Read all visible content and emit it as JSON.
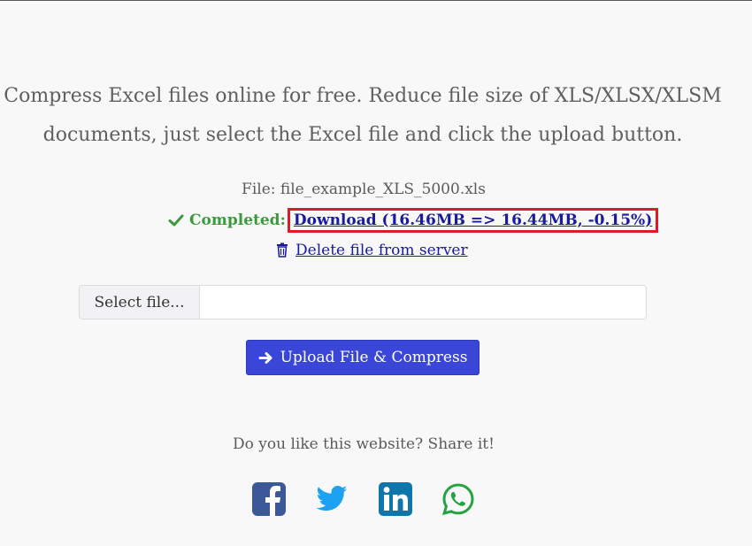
{
  "intro": {
    "line1": "Compress Excel files online for free. Reduce file size of XLS/XLSX/XLSM",
    "line2": "documents, just select the Excel file and click the upload button."
  },
  "file": {
    "label": "File: file_example_XLS_5000.xls"
  },
  "status": {
    "icon": "check-icon",
    "completed_label": "Completed:",
    "download_link": "Download (16.46MB => 16.44MB, -0.15%)",
    "highlight_color": "#e01b24"
  },
  "delete": {
    "icon": "trash-icon",
    "label": "Delete file from server"
  },
  "file_picker": {
    "button_label": "Select file...",
    "value": ""
  },
  "upload": {
    "icon": "arrow-right-icon",
    "label": "Upload File & Compress",
    "color": "#3a46d8"
  },
  "share": {
    "text": "Do you like this website? Share it!",
    "icons": [
      "facebook-icon",
      "twitter-icon",
      "linkedin-icon",
      "whatsapp-icon"
    ]
  }
}
